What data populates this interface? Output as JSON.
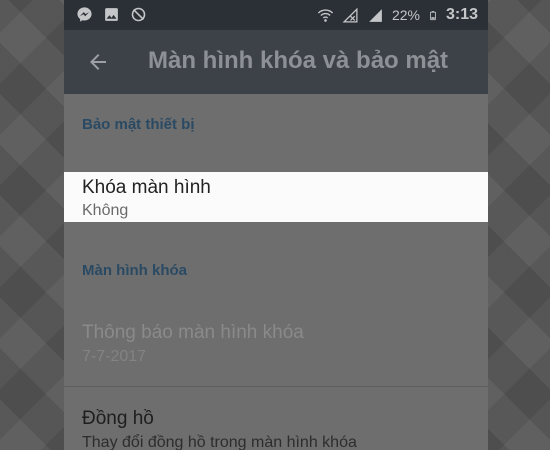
{
  "status_bar": {
    "battery_percent": "22%",
    "time": "3:13"
  },
  "app_bar": {
    "title": "Màn hình khóa và bảo mật"
  },
  "sections": [
    {
      "header": "Bảo mật thiết bị",
      "items": [
        {
          "title": "Khóa màn hình",
          "subtitle": "Không",
          "state": "highlighted"
        }
      ]
    },
    {
      "header": "Màn hình khóa",
      "items": [
        {
          "title": "Thông báo màn hình khóa",
          "subtitle": "7-7-2017",
          "state": "disabled"
        },
        {
          "title": "Đồng hồ",
          "subtitle": "Thay đổi đồng hồ trong màn hình khóa",
          "state": "normal"
        }
      ]
    }
  ],
  "icons": {
    "status_left": [
      "messenger-icon",
      "gallery-icon",
      "no-sync-icon"
    ],
    "status_right": [
      "wifi-icon",
      "no-signal-icon",
      "signal-icon",
      "battery-icon"
    ],
    "back": "back-arrow-icon"
  },
  "colors": {
    "status_bar": "#2b3036",
    "app_bar": "#3d4249",
    "dim_overlay_content": "#6e6e6e",
    "section_header": "#2a4a64",
    "highlight_row": "#fbfbfb"
  }
}
